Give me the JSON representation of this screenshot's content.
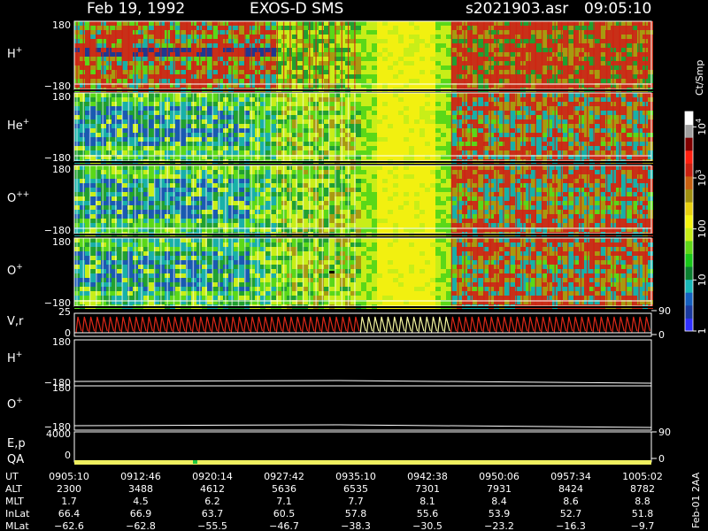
{
  "header": {
    "date": "Feb 19, 1992",
    "instrument": "EXOS-D SMS",
    "file": "s2021903.asr",
    "time": "09:05:10"
  },
  "colorbar": {
    "unit": "Ct/Smp",
    "ticks": [
      {
        "text": "1",
        "value": 1
      },
      {
        "text": "10",
        "value": 10
      },
      {
        "text": "100",
        "value": 100
      },
      {
        "text": "10",
        "sup": "3",
        "value": 1000
      },
      {
        "text": "10",
        "sup": "4",
        "value": 10000
      }
    ],
    "range": [
      1,
      20000
    ],
    "scale": "log",
    "colors": [
      "#3030ff",
      "#1a3aa0",
      "#1560c0",
      "#18b8b8",
      "#0a8030",
      "#18c818",
      "#60d818",
      "#c8ee18",
      "#f5f510",
      "#e8d010",
      "#a09010",
      "#c86010",
      "#c82010",
      "#ff2010",
      "#800000",
      "#a0a0a0",
      "#ffffff"
    ]
  },
  "footer_label": "Feb-01 2AA",
  "chart_data": {
    "type": "heatmap",
    "time_axis": {
      "labels": [
        "0905:10",
        "0912:46",
        "0920:14",
        "0927:42",
        "0935:10",
        "0942:38",
        "0950:06",
        "0957:34",
        "1005:02"
      ]
    },
    "spectrogram_panels": [
      {
        "label": "H",
        "sup": "+",
        "ylim": [
          -180,
          180
        ],
        "ticks": [
          "180",
          "−180"
        ]
      },
      {
        "label": "He",
        "sup": "+",
        "ylim": [
          -180,
          180
        ],
        "ticks": [
          "180",
          "−180"
        ]
      },
      {
        "label": "O",
        "sup": "++",
        "ylim": [
          -180,
          180
        ],
        "ticks": [
          "180",
          "−180"
        ]
      },
      {
        "label": "O",
        "sup": "+",
        "ylim": [
          -180,
          180
        ],
        "ticks": [
          "180",
          "−180"
        ]
      }
    ],
    "vr_panel": {
      "label": "V,r",
      "left_ticks": [
        "25",
        "0"
      ],
      "right_ticks": [
        "90",
        "0"
      ]
    },
    "line_panels": [
      {
        "label": "H",
        "sup": "+",
        "ticks": [
          "180",
          "−180"
        ]
      },
      {
        "label": "O",
        "sup": "+",
        "ticks": [
          "180",
          "−180"
        ]
      }
    ],
    "ep_panel": {
      "label": "E,p",
      "label2": "QA",
      "left_ticks": [
        "4000",
        "0"
      ],
      "right_ticks": [
        "90",
        "0"
      ]
    },
    "orbit_table": {
      "rows": [
        {
          "name": "UT",
          "values": [
            "0905:10",
            "0912:46",
            "0920:14",
            "0927:42",
            "0935:10",
            "0942:38",
            "0950:06",
            "0957:34",
            "1005:02"
          ]
        },
        {
          "name": "ALT",
          "values": [
            "2300",
            "3488",
            "4612",
            "5636",
            "6535",
            "7301",
            "7931",
            "8424",
            "8782"
          ]
        },
        {
          "name": "MLT",
          "values": [
            "1.7",
            "4.5",
            "6.2",
            "7.1",
            "7.7",
            "8.1",
            "8.4",
            "8.6",
            "8.8"
          ]
        },
        {
          "name": "InLat",
          "values": [
            "66.4",
            "66.9",
            "63.7",
            "60.5",
            "57.8",
            "55.6",
            "53.9",
            "52.7",
            "51.8"
          ]
        },
        {
          "name": "MLat",
          "values": [
            "−62.6",
            "−62.8",
            "−55.5",
            "−46.7",
            "−38.3",
            "−30.5",
            "−23.2",
            "−16.3",
            "−9.7"
          ]
        }
      ]
    }
  }
}
